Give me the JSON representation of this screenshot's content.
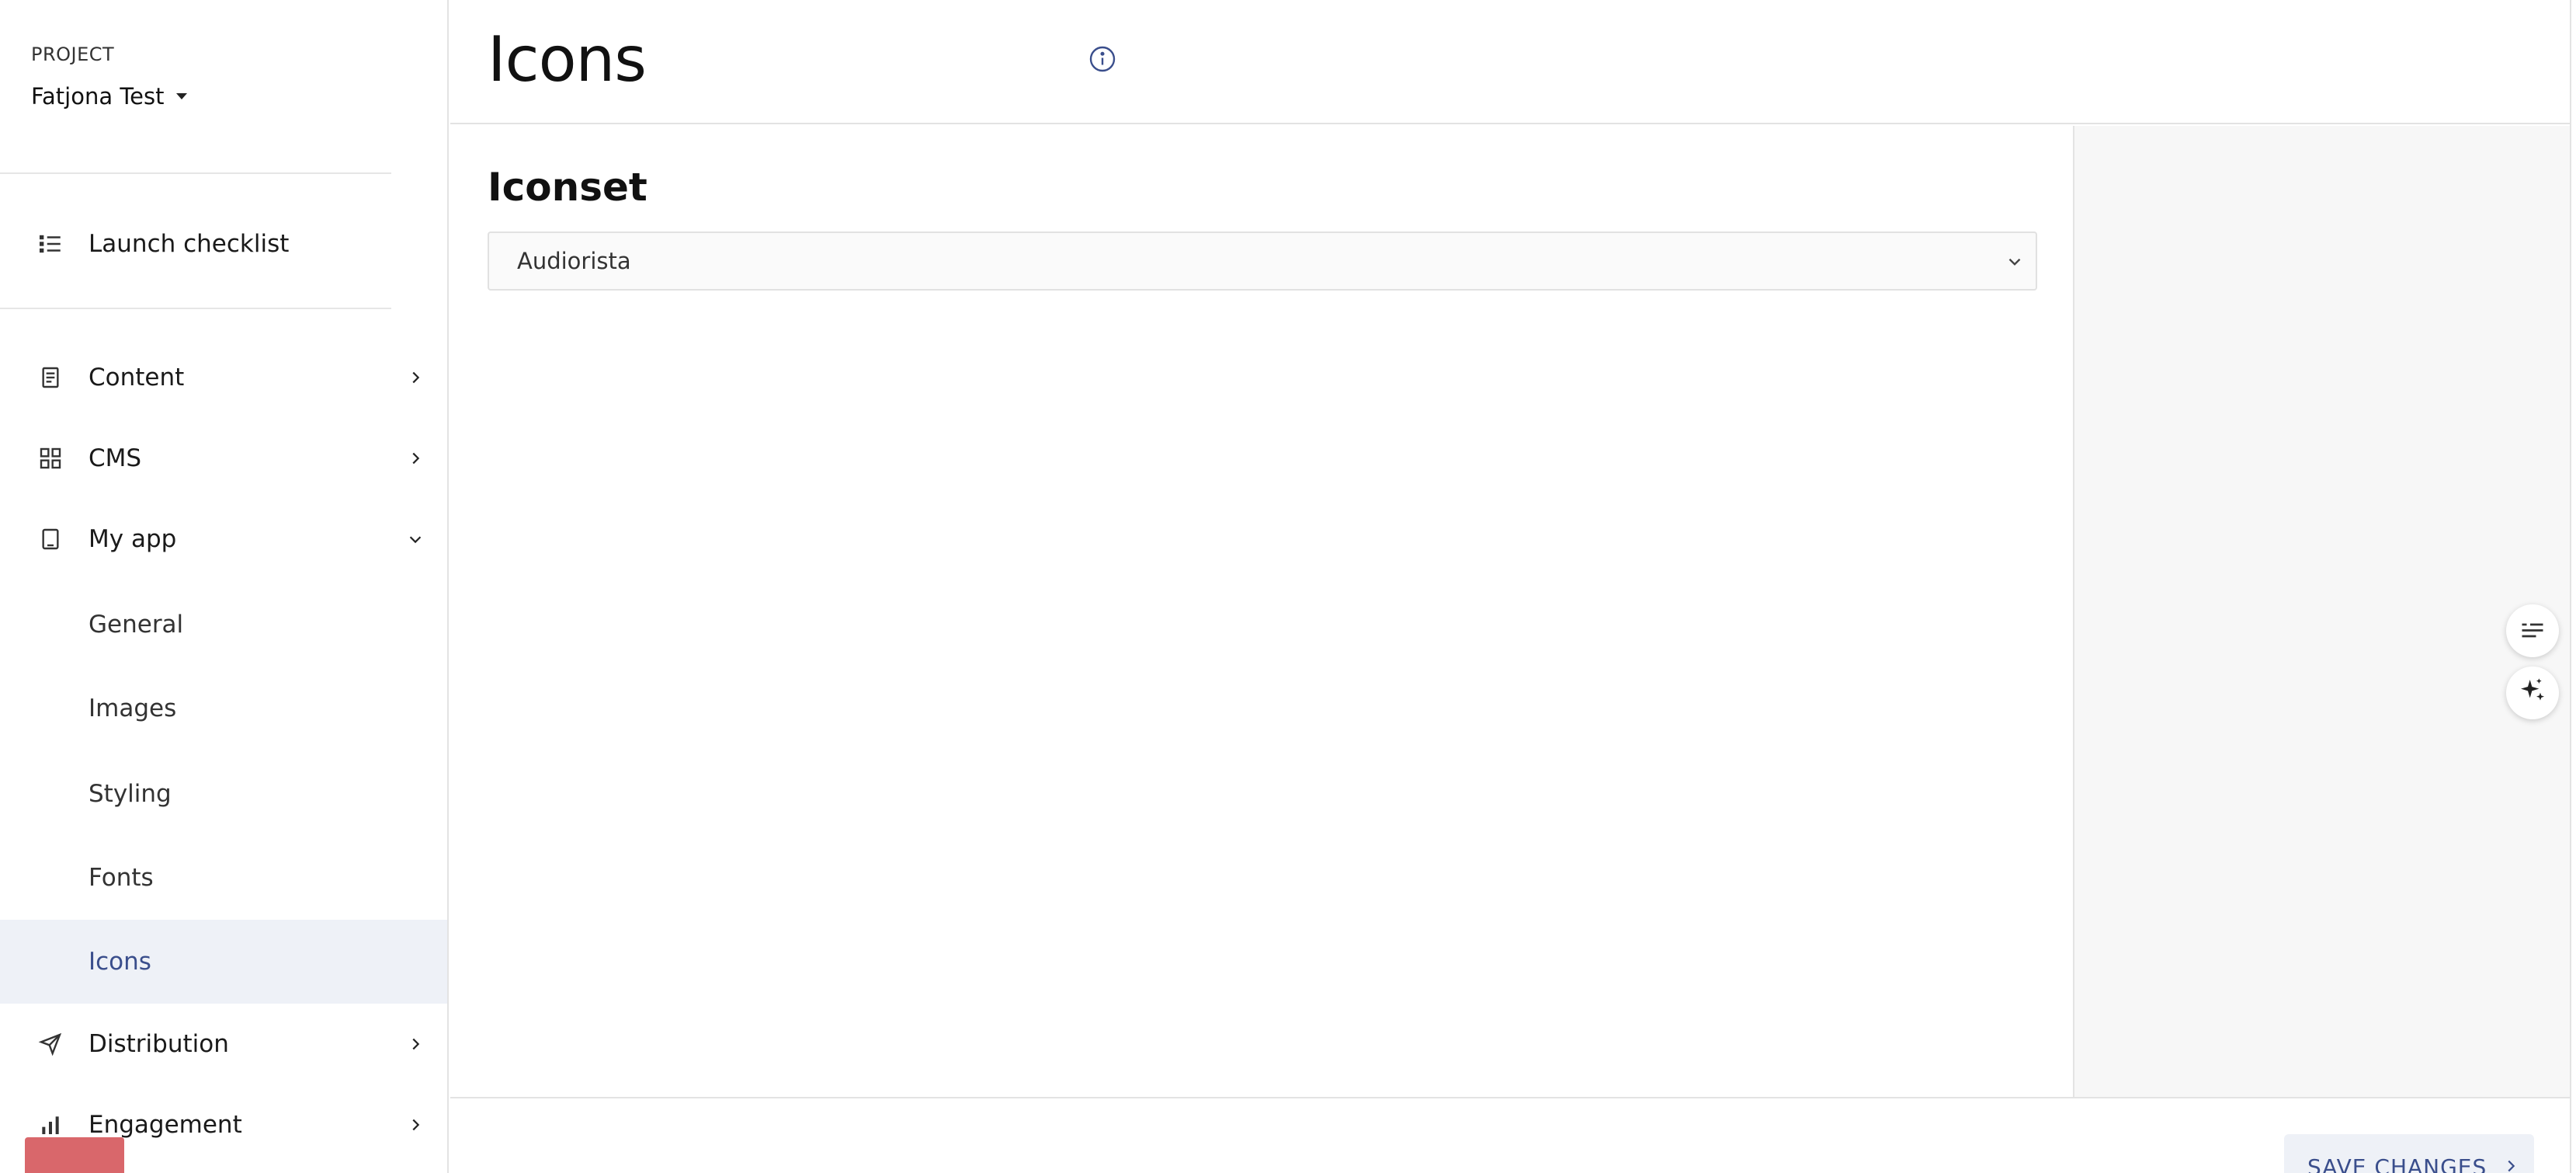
{
  "project": {
    "label": "PROJECT",
    "name": "Fatjona Test"
  },
  "sidebar": {
    "checklist": {
      "label": "Launch checklist",
      "icon": "list-icon"
    },
    "items": [
      {
        "label": "Content",
        "icon": "document-icon",
        "state": "collapsed"
      },
      {
        "label": "CMS",
        "icon": "grid-icon",
        "state": "collapsed"
      },
      {
        "label": "My app",
        "icon": "tablet-icon",
        "state": "expanded"
      }
    ],
    "subitems": [
      {
        "label": "General"
      },
      {
        "label": "Images"
      },
      {
        "label": "Styling"
      },
      {
        "label": "Fonts"
      },
      {
        "label": "Icons",
        "active": true
      }
    ],
    "bottom_items": [
      {
        "label": "Distribution",
        "icon": "send-icon",
        "state": "collapsed"
      },
      {
        "label": "Engagement",
        "icon": "bar-chart-icon",
        "state": "collapsed"
      }
    ]
  },
  "header": {
    "title": "Icons"
  },
  "main": {
    "section_title": "Iconset",
    "iconset_select": {
      "value": "Audiorista"
    }
  },
  "footer": {
    "save_label": "SAVE CHANGES"
  },
  "colors": {
    "accent": "#3a4e8c",
    "active_bg": "#eef1f7",
    "panel_bg": "#f7f7f7",
    "border": "#e3e3e3",
    "red_block": "#d9676b"
  }
}
